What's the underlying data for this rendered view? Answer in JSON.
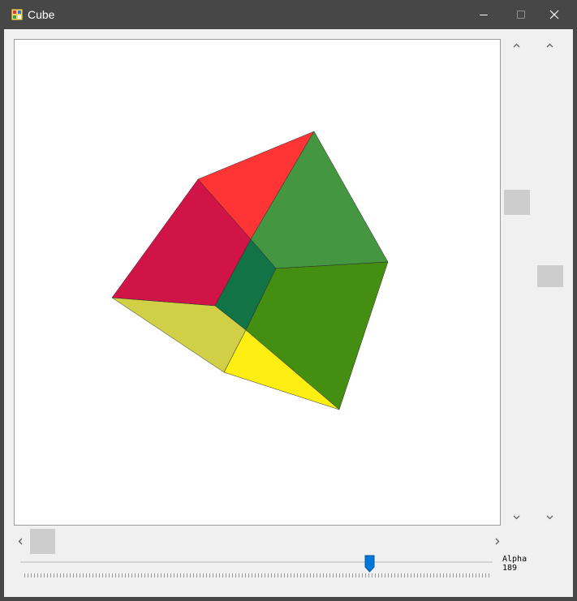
{
  "window": {
    "title": "Cube",
    "buttons": {
      "minimize": "minimize-icon",
      "maximize": "maximize-icon",
      "close": "close-icon"
    }
  },
  "cube": {
    "face_colors": {
      "red_top": "#ff3535",
      "crimson": "#d01447",
      "green_top": "#449640",
      "dark_teal": "#117346",
      "green_front": "#448f12",
      "olive": "#d0cf45",
      "yellow": "#ffee12"
    }
  },
  "scrollbars": {
    "vertical_1": {
      "position": 0.35
    },
    "vertical_2": {
      "position": 0.52
    },
    "horizontal": {
      "position": 0.0
    }
  },
  "alpha": {
    "label": "Alpha",
    "value": "189",
    "max": 255,
    "accent": "#0078d7"
  }
}
